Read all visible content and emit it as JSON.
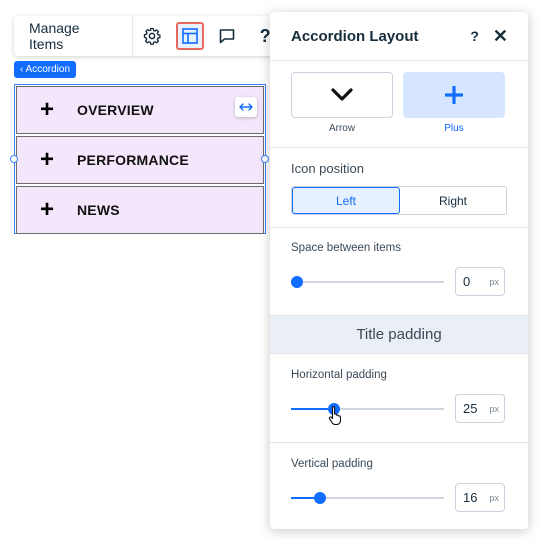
{
  "toolbar": {
    "manage_label": "Manage Items",
    "settings_icon": "gear-icon",
    "layout_icon": "layout-icon",
    "comment_icon": "comment-icon",
    "help_label": "?"
  },
  "breadcrumb": {
    "label": "‹ Accordion"
  },
  "accordion": {
    "items": [
      {
        "icon": "+",
        "label": "OVERVIEW"
      },
      {
        "icon": "+",
        "label": "PERFORMANCE"
      },
      {
        "icon": "+",
        "label": "NEWS"
      }
    ]
  },
  "panel": {
    "title": "Accordion Layout",
    "help_label": "?",
    "close_label": "✕",
    "icon_options": [
      {
        "name": "Arrow",
        "icon": "chevron-down-icon",
        "selected": false
      },
      {
        "name": "Plus",
        "icon": "plus-icon",
        "selected": true
      }
    ],
    "icon_position": {
      "title": "Icon position",
      "options": [
        "Left",
        "Right"
      ],
      "selected": "Left"
    },
    "space_between": {
      "title": "Space between items",
      "value": "0",
      "unit": "px",
      "fraction": 0.0
    },
    "title_padding_header": "Title padding",
    "horizontal_padding": {
      "title": "Horizontal padding",
      "value": "25",
      "unit": "px",
      "fraction": 0.28
    },
    "vertical_padding": {
      "title": "Vertical padding",
      "value": "16",
      "unit": "px",
      "fraction": 0.19
    }
  },
  "colors": {
    "accent": "#116dff",
    "item_bg": "#f4e6fb",
    "highlight": "#e8695e"
  }
}
